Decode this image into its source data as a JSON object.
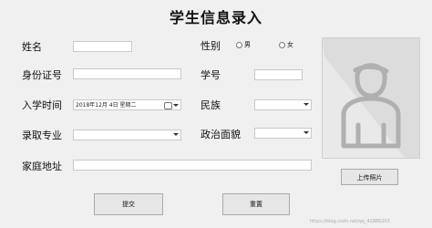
{
  "title": "学生信息录入",
  "labels": {
    "name": "姓名",
    "id_number": "身份证号",
    "enroll_time": "入学时间",
    "major": "录取专业",
    "address": "家庭地址",
    "gender": "性别",
    "student_no": "学号",
    "ethnicity": "民族",
    "political_status": "政治面貌"
  },
  "fields": {
    "name": "",
    "id_number": "",
    "enroll_date": "2018年12月  4日  星期二",
    "major": "",
    "address": "",
    "student_no": "",
    "ethnicity": "",
    "political_status": ""
  },
  "gender_options": [
    "男",
    "女"
  ],
  "buttons": {
    "upload_photo": "上传照片",
    "submit": "提交",
    "reset": "重置"
  },
  "icons": {
    "photo_placeholder": "person-avatar-icon",
    "calendar": "calendar-icon",
    "dropdown": "chevron-down-icon"
  },
  "watermark": "https://blog.csdn.net/qq_41886203"
}
